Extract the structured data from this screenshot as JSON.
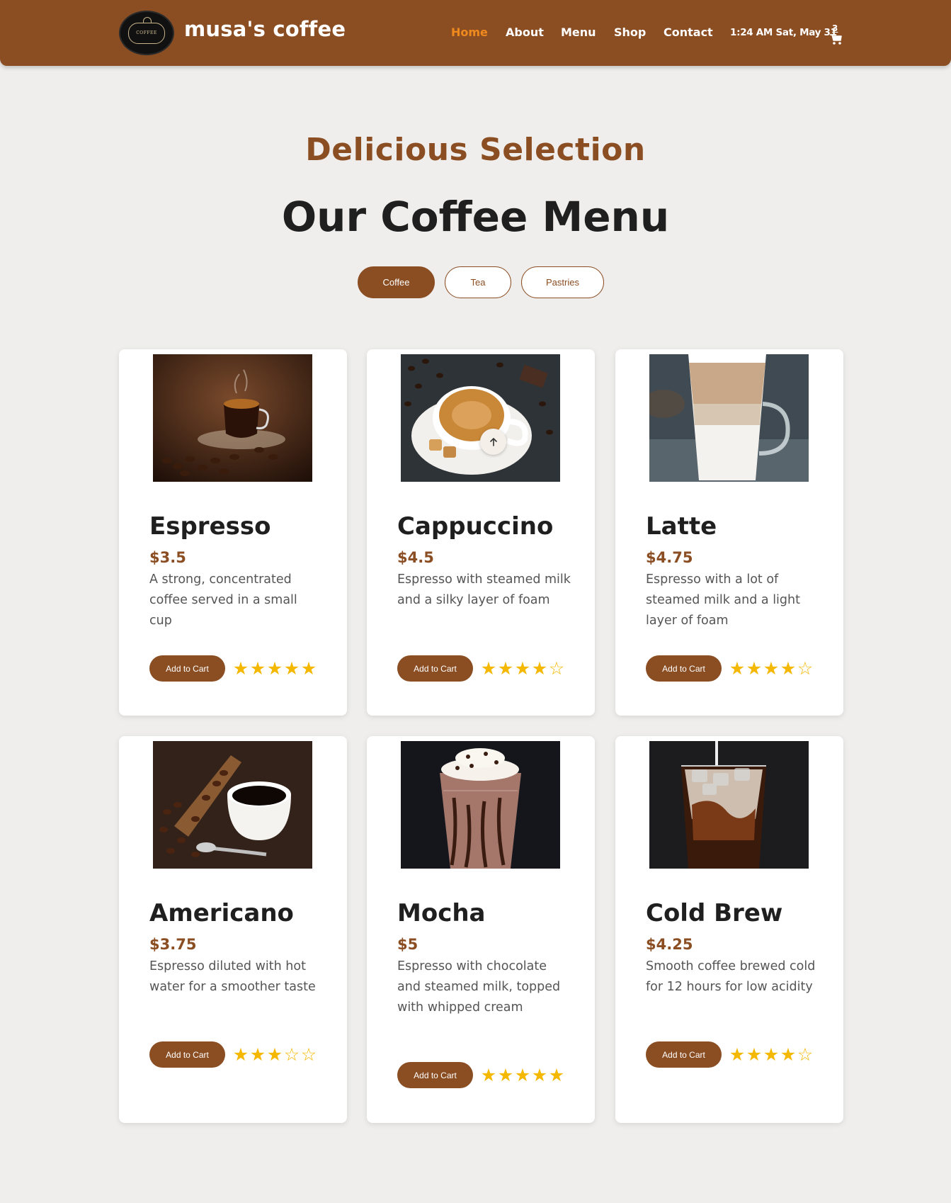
{
  "header": {
    "logo_text": "COFFEE",
    "brand": "musa's coffee",
    "nav": [
      {
        "label": "Home",
        "active": true
      },
      {
        "label": "About",
        "active": false
      },
      {
        "label": "Menu",
        "active": false
      },
      {
        "label": "Shop",
        "active": false
      },
      {
        "label": "Contact",
        "active": false
      }
    ],
    "clock": "1:24 AM Sat, May 31",
    "cart_count": "3",
    "cart_icon": "cart-icon"
  },
  "hero": {
    "subtitle": "Delicious Selection",
    "title": "Our Coffee Menu"
  },
  "tabs": [
    {
      "label": "Coffee",
      "active": true
    },
    {
      "label": "Tea",
      "active": false
    },
    {
      "label": "Pastries",
      "active": false
    }
  ],
  "products": [
    {
      "name": "Espresso",
      "price": "$3.5",
      "description": "A strong, concentrated coffee served in a small cup",
      "button": "Add to Cart",
      "rating": 5
    },
    {
      "name": "Cappuccino",
      "price": "$4.5",
      "description": "Espresso with steamed milk and a silky layer of foam",
      "button": "Add to Cart",
      "rating": 4
    },
    {
      "name": "Latte",
      "price": "$4.75",
      "description": "Espresso with a lot of steamed milk and a light layer of foam",
      "button": "Add to Cart",
      "rating": 4
    },
    {
      "name": "Americano",
      "price": "$3.75",
      "description": "Espresso diluted with hot water for a smoother taste",
      "button": "Add to Cart",
      "rating": 3
    },
    {
      "name": "Mocha",
      "price": "$5",
      "description": "Espresso with chocolate and steamed milk, topped with whipped cream",
      "button": "Add to Cart",
      "rating": 5
    },
    {
      "name": "Cold Brew",
      "price": "$4.25",
      "description": "Smooth coffee brewed cold for 12 hours for low acidity",
      "button": "Add to Cart",
      "rating": 4
    }
  ],
  "rating_max": 5,
  "scroll_up_icon": "arrow-up-icon",
  "colors": {
    "brand": "#8b4d22",
    "active_nav": "#f08a1e",
    "star": "#f5b800",
    "background": "#efeeec"
  }
}
